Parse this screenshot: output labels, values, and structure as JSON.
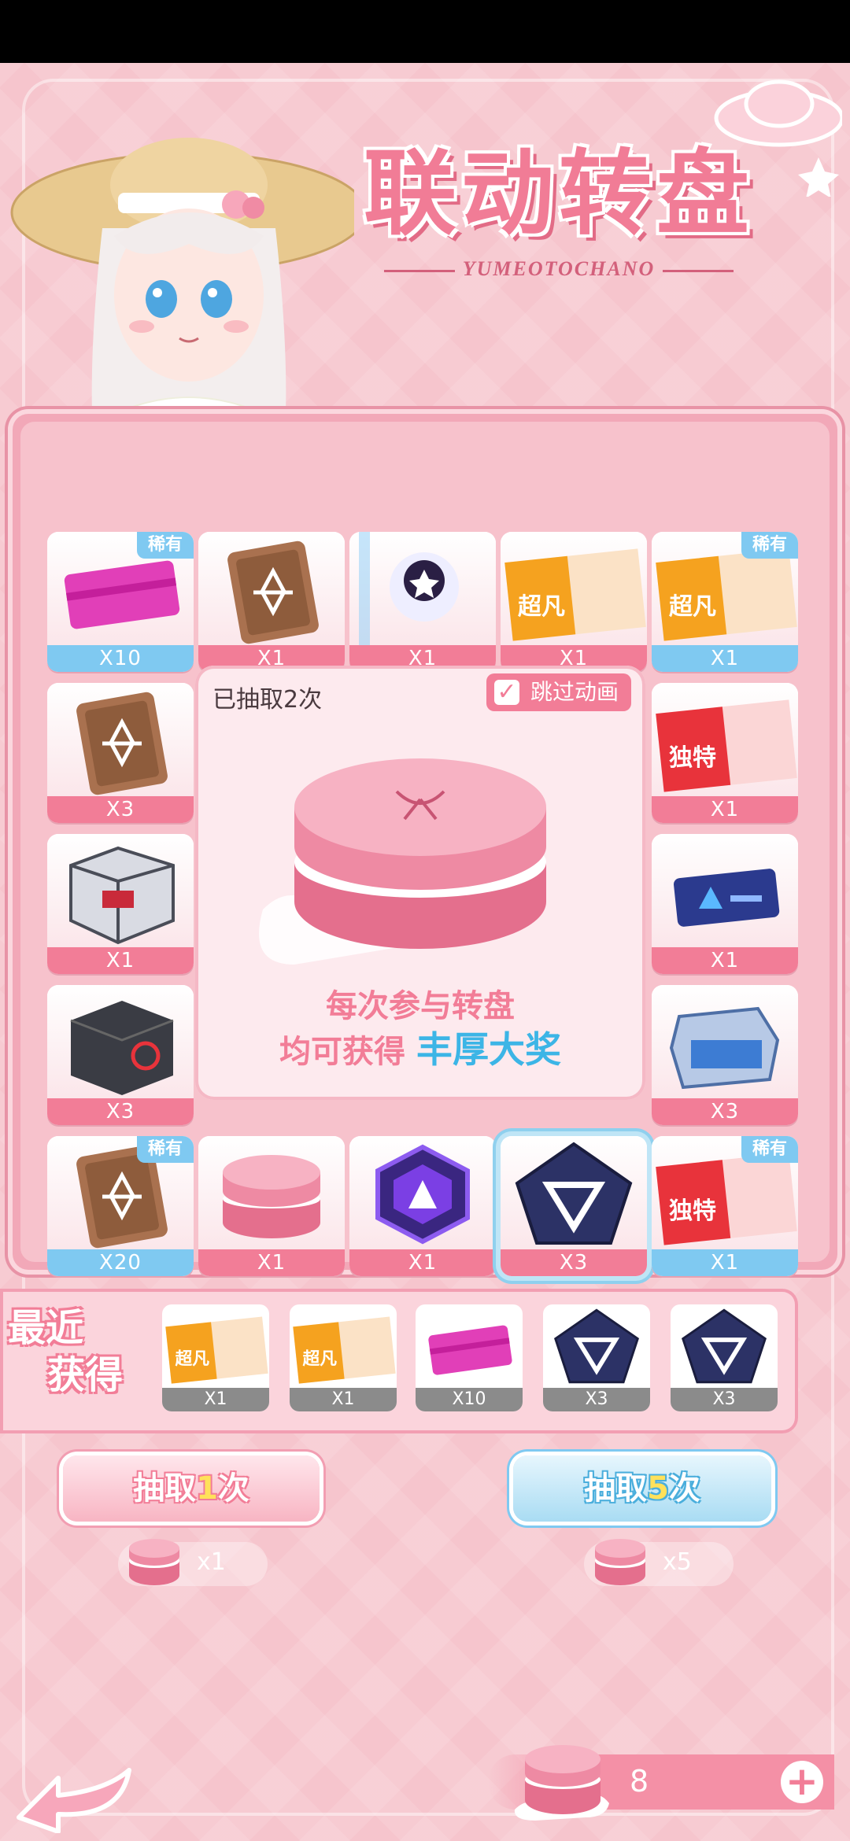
{
  "header": {
    "title": "联动转盘",
    "subtitle": "YUMEOTOCHANO"
  },
  "board": {
    "draw_count_text": "已抽取2次",
    "skip_animation_label": "跳过动画",
    "skip_animation_checked": true,
    "promo_line1": "每次参与转盘",
    "promo_line2": "均可获得",
    "promo_highlight": "丰厚大奖",
    "rare_label": "稀有",
    "items": [
      {
        "name": "pink-card",
        "qty": "X10",
        "rare": true,
        "qty_color": "blue"
      },
      {
        "name": "brown-chip",
        "qty": "X1",
        "rare": false,
        "qty_color": "pink"
      },
      {
        "name": "mecha-avatar",
        "qty": "X1",
        "rare": false,
        "qty_color": "pink"
      },
      {
        "name": "ticket-orange",
        "qty": "X1",
        "rare": false,
        "qty_color": "pink",
        "ticket_text": "超凡"
      },
      {
        "name": "ticket-orange-rare",
        "qty": "X1",
        "rare": true,
        "qty_color": "blue",
        "ticket_text": "超凡"
      },
      {
        "name": "brown-chip",
        "qty": "X3",
        "rare": false,
        "qty_color": "pink"
      },
      {
        "name": "ticket-red",
        "qty": "X1",
        "rare": false,
        "qty_color": "pink",
        "ticket_text": "独特"
      },
      {
        "name": "mech-crate",
        "qty": "X1",
        "rare": false,
        "qty_color": "pink"
      },
      {
        "name": "blue-card",
        "qty": "X1",
        "rare": false,
        "qty_color": "pink"
      },
      {
        "name": "dark-box",
        "qty": "X3",
        "rare": false,
        "qty_color": "pink"
      },
      {
        "name": "toolbox",
        "qty": "X3",
        "rare": false,
        "qty_color": "pink"
      },
      {
        "name": "brown-chip",
        "qty": "X20",
        "rare": true,
        "qty_color": "blue"
      },
      {
        "name": "macaron",
        "qty": "X1",
        "rare": false,
        "qty_color": "pink"
      },
      {
        "name": "hex-badge",
        "qty": "X1",
        "rare": false,
        "qty_color": "pink"
      },
      {
        "name": "tri-core",
        "qty": "X3",
        "rare": false,
        "qty_color": "pink",
        "selected": true
      },
      {
        "name": "ticket-red-rare",
        "qty": "X1",
        "rare": true,
        "qty_color": "blue",
        "ticket_text": "独特"
      }
    ]
  },
  "recent": {
    "label_line1": "最近",
    "label_line2": "获得",
    "items": [
      {
        "name": "ticket-orange",
        "qty": "X1",
        "ticket_text": "超凡"
      },
      {
        "name": "ticket-orange",
        "qty": "X1",
        "ticket_text": "超凡"
      },
      {
        "name": "pink-card",
        "qty": "X10"
      },
      {
        "name": "tri-core",
        "qty": "X3"
      },
      {
        "name": "tri-core",
        "qty": "X3"
      }
    ]
  },
  "actions": {
    "draw1_prefix": "抽取",
    "draw1_num": "1",
    "draw1_suffix": "次",
    "draw1_cost": "x1",
    "draw5_prefix": "抽取",
    "draw5_num": "5",
    "draw5_suffix": "次",
    "draw5_cost": "x5"
  },
  "balance": {
    "value": "8"
  },
  "colors": {
    "accent_pink": "#f27d97",
    "accent_blue": "#7fc9f1",
    "background": "#f6c5cd"
  }
}
